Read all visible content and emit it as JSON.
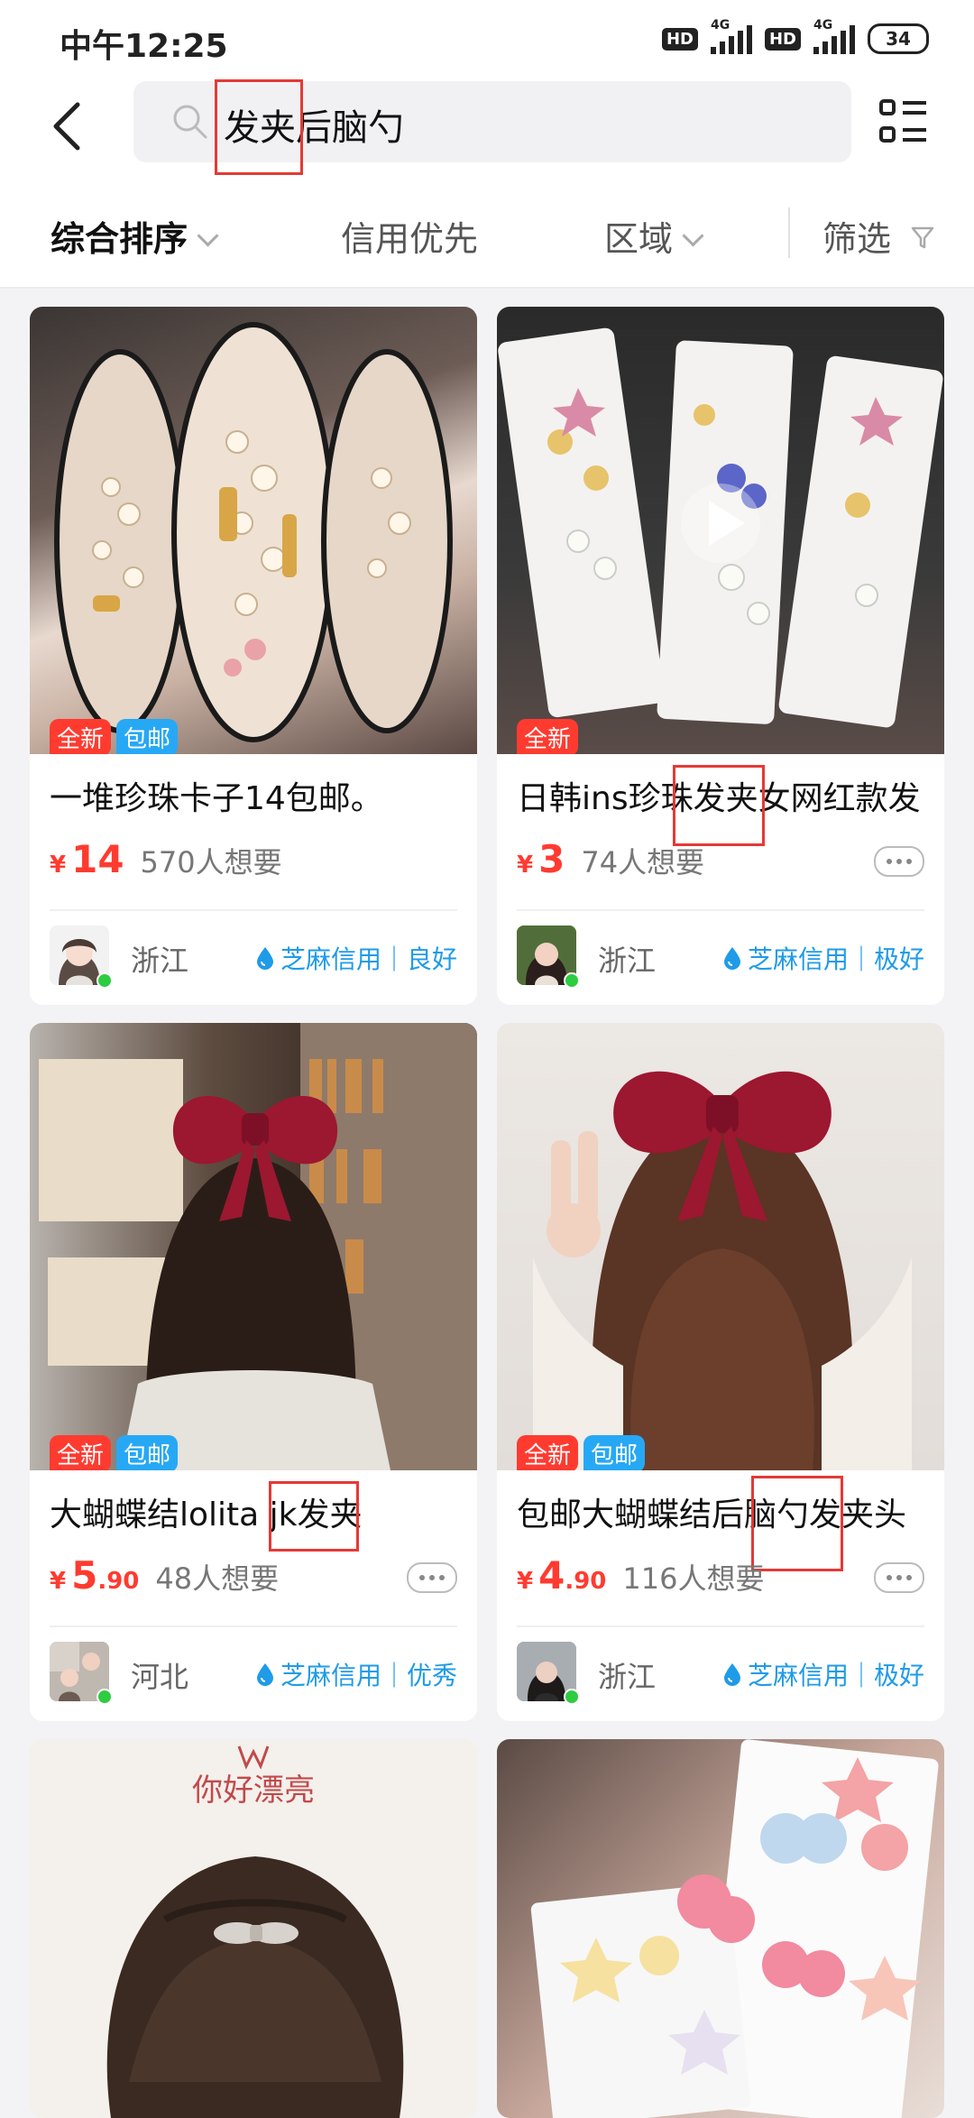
{
  "status_bar": {
    "time": "中午12:25",
    "hd1": "HD",
    "hd2": "HD",
    "net1": "4G",
    "net2": "4G",
    "battery": "34"
  },
  "search": {
    "query": "发夹后脑勺",
    "highlight": "发夹"
  },
  "sort_bar": {
    "items": [
      "综合排序",
      "信用优先",
      "区域",
      "筛选"
    ]
  },
  "products": [
    {
      "title": "一堆珍珠卡子14包邮。",
      "tags": [
        "全新",
        "包邮"
      ],
      "currency": "¥",
      "price_int": "14",
      "price_dec": "",
      "wants": "570人想要",
      "region": "浙江",
      "credit": "芝麻信用｜良好",
      "image": "pearl-hair-clips-in-pouch"
    },
    {
      "title": "日韩ins珍珠发夹女网红款发",
      "tags": [
        "全新"
      ],
      "currency": "¥",
      "price_int": "3",
      "price_dec": "",
      "wants": "74人想要",
      "region": "浙江",
      "credit": "芝麻信用｜极好",
      "image": "hair-clip-cards-video"
    },
    {
      "title": "大蝴蝶结lolita jk发夹",
      "tags": [
        "全新",
        "包邮"
      ],
      "currency": "¥",
      "price_int": "5",
      "price_dec": ".90",
      "wants": "48人想要",
      "region": "河北",
      "credit": "芝麻信用｜优秀",
      "image": "red-bow-bookstore"
    },
    {
      "title": "包邮大蝴蝶结后脑勺发夹头",
      "tags": [
        "全新",
        "包邮"
      ],
      "currency": "¥",
      "price_int": "4",
      "price_dec": ".90",
      "wants": "116人想要",
      "region": "浙江",
      "credit": "芝麻信用｜极好",
      "image": "red-bow-long-hair"
    },
    {
      "title": "",
      "image": "short-hair-clip",
      "logo_text": "你好漂亮"
    },
    {
      "title": "",
      "image": "gummy-hair-clips"
    }
  ],
  "colors": {
    "accent_red": "#ff3b30",
    "ship_blue": "#27a8f5",
    "credit_blue": "#1f9be8",
    "highlight_box": "#e53935"
  }
}
